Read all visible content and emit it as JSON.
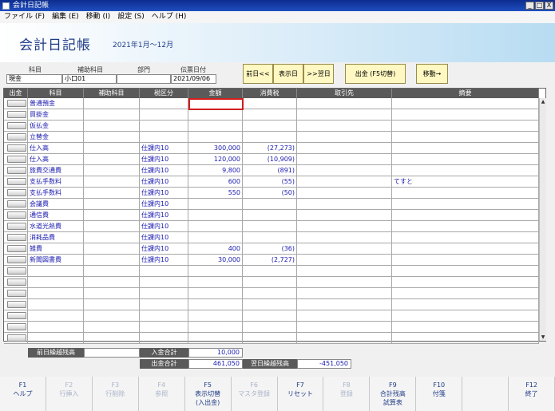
{
  "window": {
    "title": "会計日記帳",
    "min": "_",
    "max": "□",
    "close": "X"
  },
  "menu": [
    "ファイル (F)",
    "編集 (E)",
    "移動 (I)",
    "設定 (S)",
    "ヘルプ (H)"
  ],
  "banner": {
    "title": "会計日記帳",
    "period": "2021年1月～12月"
  },
  "header": {
    "labels": {
      "account": "科目",
      "sub_account": "補助科目",
      "department": "部門",
      "slip_date": "伝票日付"
    },
    "values": {
      "account": "現金",
      "sub_account": "小口01",
      "department": "",
      "slip_date": "2021/09/06"
    }
  },
  "buttons": {
    "prev_day": "前日<<",
    "show_day": "表示日",
    "next_day": ">>翌日",
    "in_out": "出金 (F5切替)",
    "move": "移動→"
  },
  "columns": [
    "出金",
    "科目",
    "補助科目",
    "税区分",
    "金額",
    "消費税",
    "取引先",
    "摘要"
  ],
  "rows": [
    {
      "account": "普通預金",
      "tax_class": "",
      "amount": "",
      "tax": "",
      "partner": "",
      "memo": ""
    },
    {
      "account": "買掛金",
      "tax_class": "",
      "amount": "",
      "tax": "",
      "partner": "",
      "memo": ""
    },
    {
      "account": "仮払金",
      "tax_class": "",
      "amount": "",
      "tax": "",
      "partner": "",
      "memo": ""
    },
    {
      "account": "立替金",
      "tax_class": "",
      "amount": "",
      "tax": "",
      "partner": "",
      "memo": ""
    },
    {
      "account": "仕入高",
      "tax_class": "仕課内10",
      "amount": "300,000",
      "tax": "(27,273)",
      "partner": "",
      "memo": ""
    },
    {
      "account": "仕入高",
      "tax_class": "仕課内10",
      "amount": "120,000",
      "tax": "(10,909)",
      "partner": "",
      "memo": ""
    },
    {
      "account": "旅費交通費",
      "tax_class": "仕課内10",
      "amount": "9,800",
      "tax": "(891)",
      "partner": "",
      "memo": ""
    },
    {
      "account": "支払手数料",
      "tax_class": "仕課内10",
      "amount": "600",
      "tax": "(55)",
      "partner": "",
      "memo": "てすと"
    },
    {
      "account": "支払手数料",
      "tax_class": "仕課内10",
      "amount": "550",
      "tax": "(50)",
      "partner": "",
      "memo": ""
    },
    {
      "account": "会議費",
      "tax_class": "仕課内10",
      "amount": "",
      "tax": "",
      "partner": "",
      "memo": ""
    },
    {
      "account": "通信費",
      "tax_class": "仕課内10",
      "amount": "",
      "tax": "",
      "partner": "",
      "memo": ""
    },
    {
      "account": "水道光熱費",
      "tax_class": "仕課内10",
      "amount": "",
      "tax": "",
      "partner": "",
      "memo": ""
    },
    {
      "account": "消耗品費",
      "tax_class": "仕課内10",
      "amount": "",
      "tax": "",
      "partner": "",
      "memo": ""
    },
    {
      "account": "雑費",
      "tax_class": "仕課内10",
      "amount": "400",
      "tax": "(36)",
      "partner": "",
      "memo": ""
    },
    {
      "account": "新聞図書費",
      "tax_class": "仕課内10",
      "amount": "30,000",
      "tax": "(2,727)",
      "partner": "",
      "memo": ""
    },
    {
      "account": "",
      "tax_class": "",
      "amount": "",
      "tax": "",
      "partner": "",
      "memo": ""
    },
    {
      "account": "",
      "tax_class": "",
      "amount": "",
      "tax": "",
      "partner": "",
      "memo": ""
    },
    {
      "account": "",
      "tax_class": "",
      "amount": "",
      "tax": "",
      "partner": "",
      "memo": ""
    },
    {
      "account": "",
      "tax_class": "",
      "amount": "",
      "tax": "",
      "partner": "",
      "memo": ""
    },
    {
      "account": "",
      "tax_class": "",
      "amount": "",
      "tax": "",
      "partner": "",
      "memo": ""
    },
    {
      "account": "",
      "tax_class": "",
      "amount": "",
      "tax": "",
      "partner": "",
      "memo": ""
    },
    {
      "account": "",
      "tax_class": "",
      "amount": "",
      "tax": "",
      "partner": "",
      "memo": ""
    }
  ],
  "totals": {
    "prev_balance_label": "前日繰越残高",
    "prev_balance": "",
    "income_label": "入金合計",
    "income": "10,000",
    "expense_label": "出金合計",
    "expense": "461,050",
    "next_balance_label": "翌日繰越残高",
    "next_balance": "-451,050"
  },
  "fkeys": [
    {
      "key": "F1",
      "label": "ヘルプ",
      "label2": "",
      "enabled": true
    },
    {
      "key": "F2",
      "label": "行挿入",
      "label2": "",
      "enabled": false
    },
    {
      "key": "F3",
      "label": "行削除",
      "label2": "",
      "enabled": false
    },
    {
      "key": "F4",
      "label": "参照",
      "label2": "",
      "enabled": false
    },
    {
      "key": "F5",
      "label": "表示切替",
      "label2": "(入出金)",
      "enabled": true
    },
    {
      "key": "F6",
      "label": "マスタ登録",
      "label2": "",
      "enabled": false
    },
    {
      "key": "F7",
      "label": "リセット",
      "label2": "",
      "enabled": true
    },
    {
      "key": "F8",
      "label": "登録",
      "label2": "",
      "enabled": false
    },
    {
      "key": "F9",
      "label": "合計残高",
      "label2": "試算表",
      "enabled": true
    },
    {
      "key": "F10",
      "label": "付箋",
      "label2": "",
      "enabled": true
    },
    {
      "key": "",
      "label": "",
      "label2": "",
      "enabled": false
    },
    {
      "key": "F12",
      "label": "終了",
      "label2": "",
      "enabled": true
    }
  ]
}
